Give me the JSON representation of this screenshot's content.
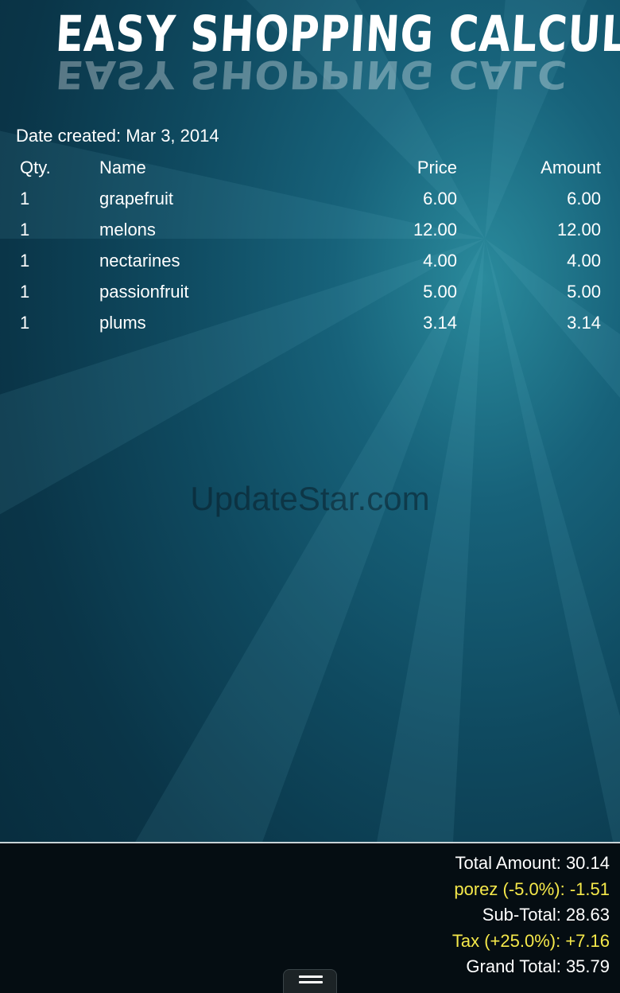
{
  "app": {
    "title": "Easy Shopping Calculator"
  },
  "list": {
    "date_label": "Date created: Mar 3, 2014",
    "headers": {
      "qty": "Qty.",
      "name": "Name",
      "price": "Price",
      "amount": "Amount"
    },
    "items": [
      {
        "qty": "1",
        "name": "grapefruit",
        "price": "6.00",
        "amount": "6.00"
      },
      {
        "qty": "1",
        "name": "melons",
        "price": "12.00",
        "amount": "12.00"
      },
      {
        "qty": "1",
        "name": "nectarines",
        "price": "4.00",
        "amount": "4.00"
      },
      {
        "qty": "1",
        "name": "passionfruit",
        "price": "5.00",
        "amount": "5.00"
      },
      {
        "qty": "1",
        "name": "plums",
        "price": "3.14",
        "amount": "3.14"
      }
    ]
  },
  "watermark": "UpdateStar.com",
  "totals": {
    "total_amount": "Total Amount: 30.14",
    "discount": "porez (-5.0%): -1.51",
    "sub_total": "Sub-Total: 28.63",
    "tax": "Tax (+25.0%): +7.16",
    "grand_total": "Grand Total: 35.79"
  },
  "colors": {
    "accent_yellow": "#f5e84a",
    "background_teal": "#17627a"
  },
  "icons": {
    "menu": "menu-icon"
  }
}
